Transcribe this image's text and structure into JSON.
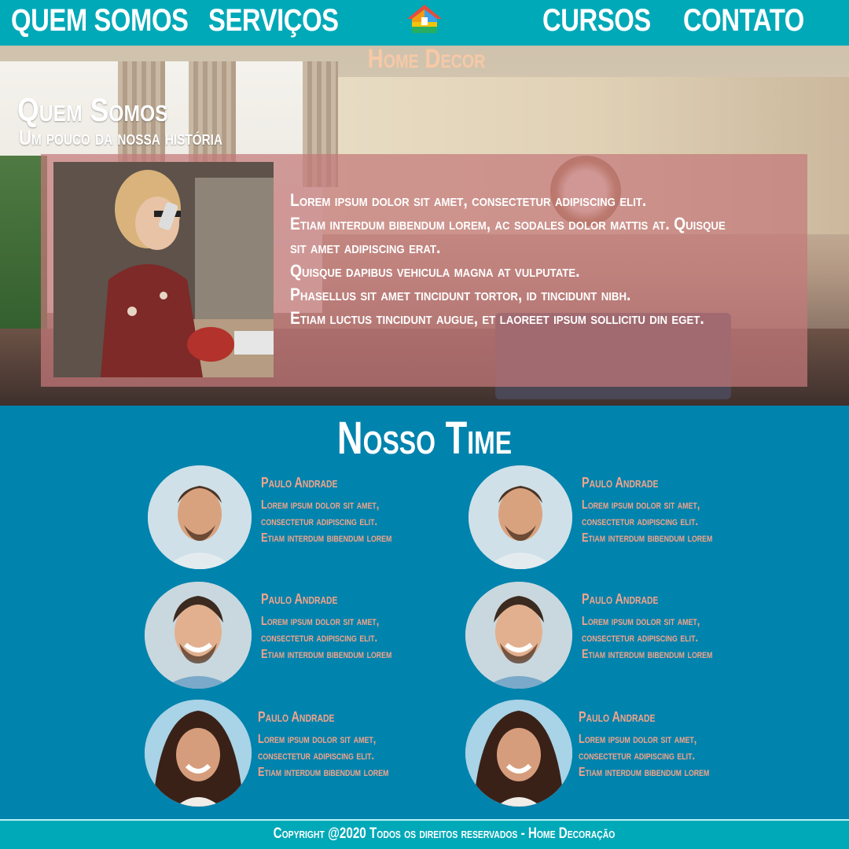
{
  "nav": {
    "items": [
      {
        "label": "QUEM SOMOS"
      },
      {
        "label": "SERVIÇOS"
      },
      {
        "label": "CURSOS"
      },
      {
        "label": "CONTATO"
      }
    ],
    "logo_icon": "house-logo-icon",
    "brand": "Home Decor"
  },
  "colors": {
    "nav": "#00a9b8",
    "main": "#0083ad",
    "accent": "#f2a48b",
    "overlay": "#c4787a"
  },
  "about": {
    "title": "Quem Somos",
    "subtitle": "Um pouco da nossa história",
    "text": "Lorem ipsum dolor sit amet, consectetur adipiscing elit.\n Etiam interdum bibendum lorem, ac sodales dolor mattis at. Quisque sit amet adipiscing erat.\nQuisque dapibus vehicula magna at vulputate.\nPhasellus sit amet tincidunt tortor, id tincidunt nibh.\nEtiam luctus tincidunt augue, et laoreet ipsum sollicitu din eget."
  },
  "team": {
    "title": "Nosso Time",
    "members": [
      {
        "name": "Paulo Andrade",
        "desc": "Lorem ipsum dolor sit amet,\nconsectetur adipiscing elit.\nEtiam interdum bibendum lorem"
      },
      {
        "name": "Paulo Andrade",
        "desc": "Lorem ipsum dolor sit amet,\nconsectetur adipiscing elit.\nEtiam interdum bibendum lorem"
      },
      {
        "name": "Paulo Andrade",
        "desc": "Lorem ipsum dolor sit amet,\nconsectetur adipiscing elit.\nEtiam interdum bibendum lorem"
      },
      {
        "name": "Paulo Andrade",
        "desc": "Lorem ipsum dolor sit amet,\nconsectetur adipiscing elit.\nEtiam interdum bibendum lorem"
      },
      {
        "name": "Paulo Andrade",
        "desc": "Lorem ipsum dolor sit amet,\nconsectetur adipiscing elit.\nEtiam interdum bibendum lorem"
      },
      {
        "name": "Paulo Andrade",
        "desc": "Lorem ipsum dolor sit amet,\nconsectetur adipiscing elit.\nEtiam interdum bibendum lorem"
      }
    ]
  },
  "footer": {
    "text": "Copyright @2020 Todos os direitos reservados - Home Decoração"
  }
}
